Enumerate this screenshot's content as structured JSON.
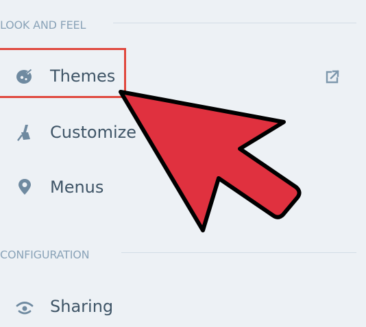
{
  "sections": {
    "look_and_feel": {
      "title": "LOOK AND FEEL",
      "items": [
        {
          "label": "Themes",
          "icon": "palette-icon"
        },
        {
          "label": "Customize",
          "icon": "paintbrush-icon"
        },
        {
          "label": "Menus",
          "icon": "map-pin-icon"
        }
      ]
    },
    "configuration": {
      "title": "CONFIGURATION",
      "items": [
        {
          "label": "Sharing",
          "icon": "share-icon"
        }
      ]
    }
  },
  "icons": {
    "themes_external": "external-link-icon"
  },
  "colors": {
    "background": "#edf1f5",
    "section_text": "#8aa3b8",
    "item_text": "#3e5466",
    "icon": "#6f8aa0",
    "highlight_border": "#e0463c",
    "arrow_fill": "#e0313f",
    "arrow_stroke": "#000000"
  }
}
